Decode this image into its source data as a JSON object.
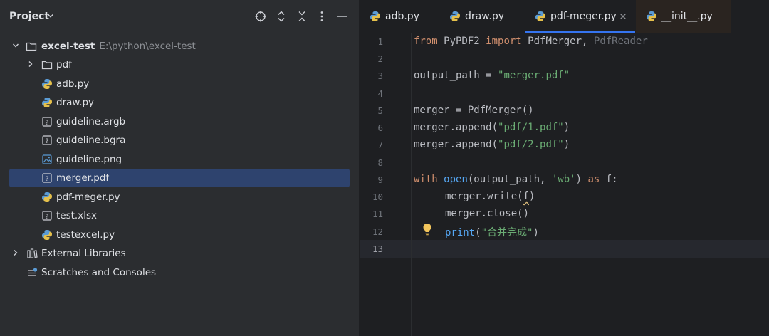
{
  "project_panel": {
    "title": "Project",
    "tree": {
      "root_name": "excel-test",
      "root_path": "E:\\python\\excel-test",
      "items": [
        {
          "label": "pdf",
          "type": "folder"
        },
        {
          "label": "adb.py",
          "type": "python"
        },
        {
          "label": "draw.py",
          "type": "python"
        },
        {
          "label": "guideline.argb",
          "type": "unknown"
        },
        {
          "label": "guideline.bgra",
          "type": "unknown"
        },
        {
          "label": "guideline.png",
          "type": "image"
        },
        {
          "label": "merger.pdf",
          "type": "unknown"
        },
        {
          "label": "pdf-meger.py",
          "type": "python"
        },
        {
          "label": "test.xlsx",
          "type": "unknown"
        },
        {
          "label": "testexcel.py",
          "type": "python"
        }
      ],
      "external_libraries": "External Libraries",
      "scratches": "Scratches and Consoles"
    }
  },
  "editor": {
    "tabs": [
      {
        "label": "adb.py"
      },
      {
        "label": "draw.py"
      },
      {
        "label": "pdf-meger.py"
      },
      {
        "label": "__init__.py"
      }
    ],
    "line_numbers": [
      "1",
      "2",
      "3",
      "4",
      "5",
      "6",
      "7",
      "8",
      "9",
      "10",
      "11",
      "12",
      "13"
    ],
    "code": {
      "l1_from": "from",
      "l1_mod": " PyPDF2 ",
      "l1_import": "import",
      "l1_names": " PdfMerger, ",
      "l1_unused": "PdfReader",
      "l3_var": "output_path = ",
      "l3_str": "\"merger.pdf\"",
      "l5": "merger = PdfMerger()",
      "l6_a": "merger.append(",
      "l6_s": "\"pdf/1.pdf\"",
      "l6_b": ")",
      "l7_a": "merger.append(",
      "l7_s": "\"pdf/2.pdf\"",
      "l7_b": ")",
      "l9_with": "with",
      "l9_sp": " ",
      "l9_open": "open",
      "l9_args": "(output_path, ",
      "l9_mode": "'wb'",
      "l9_close": ") ",
      "l9_as": "as",
      "l9_f": " f:",
      "l10_a": "merger.write(",
      "l10_f": "f",
      "l10_b": ")",
      "l11": "merger.close()",
      "l12_print": "print",
      "l12_a": "(",
      "l12_s": "\"合并完成\"",
      "l12_b": ")"
    }
  }
}
